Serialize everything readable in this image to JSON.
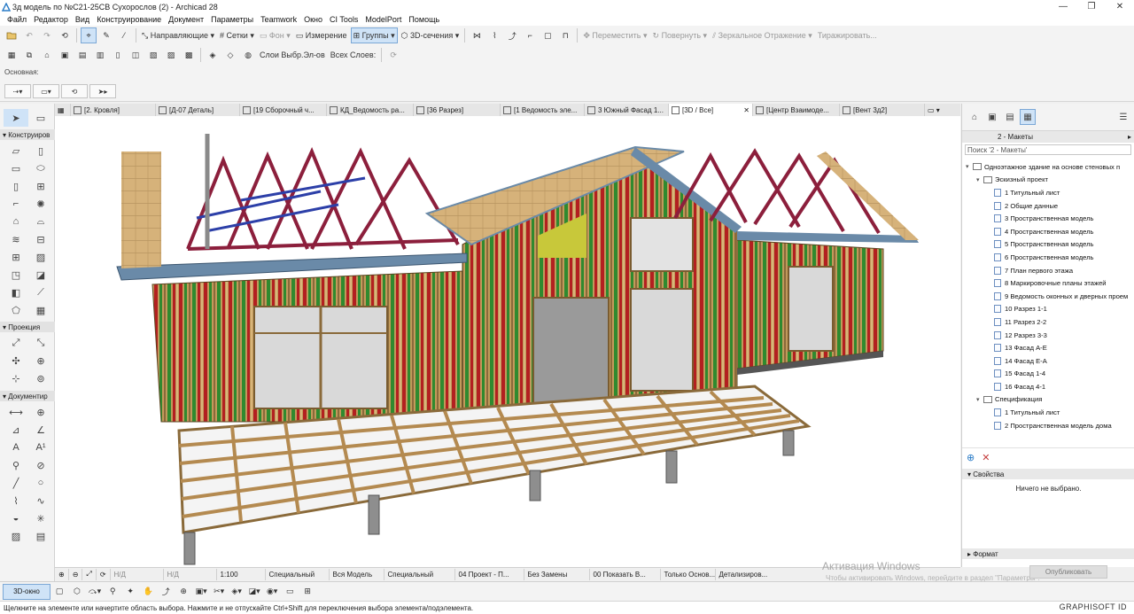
{
  "window": {
    "title": "3д модель по №С21-25СВ Сухорослов (2) - Archicad 28",
    "min": "—",
    "max": "❐",
    "close": "✕"
  },
  "menu": [
    "Файл",
    "Редактор",
    "Вид",
    "Конструирование",
    "Документ",
    "Параметры",
    "Teamwork",
    "Окно",
    "CI Tools",
    "ModelPort",
    "Помощь"
  ],
  "toolbar1": {
    "guides": "Направляющие",
    "grids": "Сетки",
    "background": "Фон",
    "measure": "Измерение",
    "groups": "Группы",
    "sections3d": "3D-сечения",
    "move": "Переместить",
    "rotate": "Повернуть",
    "mirror": "Зеркальное Отражение",
    "multiply": "Тиражировать..."
  },
  "toolbar2": {
    "layers_sel": "Слои Выбр.Эл-ов",
    "layers_all": "Всех Слоев:"
  },
  "infobox": {
    "label": "Основная:"
  },
  "tabs": [
    {
      "label": "[2. Кровля]"
    },
    {
      "label": "[Д-07 Деталь]"
    },
    {
      "label": "[19 Сборочный ч..."
    },
    {
      "label": "КД_Ведомость ра..."
    },
    {
      "label": "[36 Разрез]"
    },
    {
      "label": "[1 Ведомость эле..."
    },
    {
      "label": "3 Южный Фасад 1..."
    },
    {
      "label": "[3D / Все]"
    },
    {
      "label": "[Центр Взаимоде..."
    },
    {
      "label": "[Вент 3д2]"
    }
  ],
  "toolbox": {
    "sec1": "Конструиров",
    "sec2": "Проекция",
    "sec3": "Документир"
  },
  "navigator": {
    "selector": "2 - Макеты",
    "search_placeholder": "Поиск '2 - Макеты'",
    "tree": [
      {
        "level": 0,
        "kind": "root",
        "label": "Одноэтажное здание на основе стеновых п"
      },
      {
        "level": 1,
        "kind": "folder",
        "label": "Эскизный проект"
      },
      {
        "level": 2,
        "kind": "page",
        "label": "1 Титульный лист"
      },
      {
        "level": 2,
        "kind": "page",
        "label": "2 Общие данные"
      },
      {
        "level": 2,
        "kind": "page",
        "label": "3 Пространственная модель"
      },
      {
        "level": 2,
        "kind": "page",
        "label": "4 Пространственная модель"
      },
      {
        "level": 2,
        "kind": "page",
        "label": "5 Пространственная модель"
      },
      {
        "level": 2,
        "kind": "page",
        "label": "6 Пространственная модель"
      },
      {
        "level": 2,
        "kind": "page",
        "label": "7 План первого этажа"
      },
      {
        "level": 2,
        "kind": "page",
        "label": "8 Маркировочные планы этажей"
      },
      {
        "level": 2,
        "kind": "page",
        "label": "9 Ведомость оконных и дверных проем"
      },
      {
        "level": 2,
        "kind": "page",
        "label": "10 Разрез 1-1"
      },
      {
        "level": 2,
        "kind": "page",
        "label": "11 Разрез 2-2"
      },
      {
        "level": 2,
        "kind": "page",
        "label": "12 Разрез 3-3"
      },
      {
        "level": 2,
        "kind": "page",
        "label": "13 Фасад А-Е"
      },
      {
        "level": 2,
        "kind": "page",
        "label": "14 Фасад Е-А"
      },
      {
        "level": 2,
        "kind": "page",
        "label": "15 Фасад 1-4"
      },
      {
        "level": 2,
        "kind": "page",
        "label": "16 Фасад 4-1"
      },
      {
        "level": 1,
        "kind": "folder",
        "label": "Спецификация"
      },
      {
        "level": 2,
        "kind": "page",
        "label": "1 Титульный лист"
      },
      {
        "level": 2,
        "kind": "page",
        "label": "2 Пространственная модель дома"
      }
    ],
    "properties_title": "Свойства",
    "properties_empty": "Ничего не выбрано.",
    "format_title": "Формат",
    "publish": "Опубликовать"
  },
  "quickbar": {
    "scale": "1:100",
    "nd1": "Н/Д",
    "nd2": "Н/Д",
    "special1": "Специальный",
    "model": "Вся Модель",
    "special2": "Специальный",
    "project": "04 Проект - П...",
    "overrides": "Без Замены",
    "show": "00 Показать В...",
    "only": "Только Основ...",
    "detail": "Детализиров..."
  },
  "watermark": {
    "line1": "Активация Windows",
    "line2": "Чтобы активировать Windows, перейдите в раздел \"Параметры\"."
  },
  "bottom": {
    "view3d": "3D-окно"
  },
  "status": {
    "text": "Щелкните на элементе или начертите область выбора. Нажмите и не отпускайте Ctrl+Shift для переключения выбора элемента/подэлемента.",
    "brand": "GRAPHISOFT ID"
  },
  "colors": {
    "accent": "#cfe3f7",
    "truss_red": "#8c1f3c",
    "truss_blue": "#2c3fa8",
    "wood": "#c9a46a",
    "wall_green": "#2f8a2f",
    "wall_red": "#b32020"
  }
}
